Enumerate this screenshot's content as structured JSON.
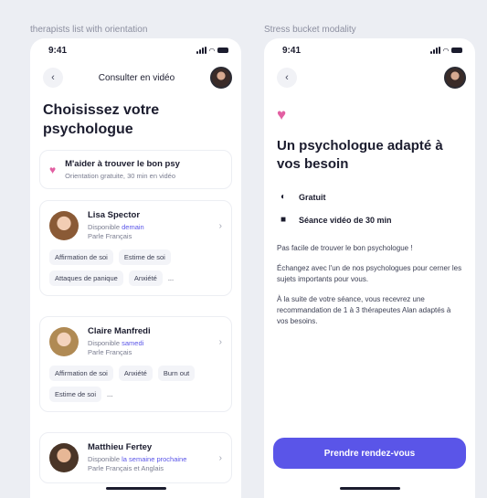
{
  "frames": {
    "left_label": "therapists list with orientation",
    "right_label": "Stress bucket modality"
  },
  "status_bar": {
    "time": "9:41"
  },
  "left": {
    "nav_title": "Consulter en vidéo",
    "headline": "Choisissez votre psychologue",
    "helper_card": {
      "title": "M'aider à trouver le bon psy",
      "subtitle": "Orientation gratuite, 30 min en vidéo"
    },
    "therapists": [
      {
        "name": "Lisa Spector",
        "availability_prefix": "Disponible ",
        "availability_value": "demain",
        "languages": "Parle Français",
        "tags": [
          "Affirmation de soi",
          "Estime de soi",
          "Attaques de panique",
          "Anxiété",
          "..."
        ]
      },
      {
        "name": "Claire Manfredi",
        "availability_prefix": "Disponible ",
        "availability_value": "samedi",
        "languages": "Parle Français",
        "tags": [
          "Affirmation de soi",
          "Anxiété",
          "Burn out",
          "Estime de soi",
          "..."
        ]
      },
      {
        "name": "Matthieu Fertey",
        "availability_prefix": "Disponible ",
        "availability_value": "la semaine prochaine",
        "languages": "Parle Français et Anglais",
        "tags": []
      }
    ]
  },
  "right": {
    "headline": "Un psychologue adapté à vos besoin",
    "features": [
      {
        "icon": "coin-icon",
        "label": "Gratuit"
      },
      {
        "icon": "video-icon",
        "label": "Séance vidéo de 30 min"
      }
    ],
    "paragraphs": [
      "Pas facile de trouver le bon psychologue !",
      "Échangez avec l'un de nos psychologues pour cerner les sujets importants pour vous.",
      "À la suite de votre séance, vous recevrez une recommandation de 1 à 3 thérapeutes Alan adaptés à vos besoins."
    ],
    "cta": "Prendre rendez-vous"
  },
  "colors": {
    "accent": "#5a55e8",
    "heart": "#e25fa2",
    "canvas": "#eceef3"
  }
}
